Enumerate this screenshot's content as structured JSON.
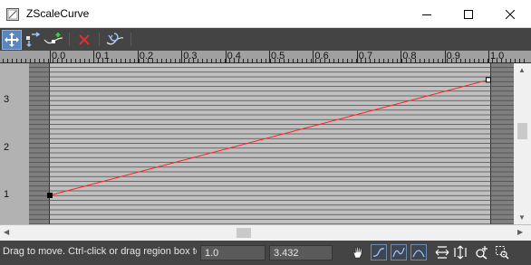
{
  "window": {
    "title": "ZScaleCurve",
    "minimize_icon": "minimize-icon",
    "maximize_icon": "maximize-icon",
    "close_icon": "close-icon"
  },
  "toolbar": {
    "tools": [
      "move-icon",
      "scale-point-icon",
      "insert-point-icon",
      "delete-point-icon",
      "reset-curve-icon"
    ]
  },
  "ruler": {
    "ticks": [
      "0.0",
      "0.1",
      "0.2",
      "0.3",
      "0.4",
      "0.5",
      "0.6",
      "0.7",
      "0.8",
      "0.9",
      "1.0"
    ]
  },
  "y_axis": {
    "labels": [
      "3",
      "2",
      "1"
    ]
  },
  "curve": {
    "points": [
      {
        "x": 0.0,
        "y": 1.0
      },
      {
        "x": 1.0,
        "y": 3.432
      }
    ],
    "color": "#ff2020"
  },
  "status": {
    "message": "Drag to move. Ctrl-click or drag region box to select.",
    "x_value": "1.0",
    "y_value": "3.432"
  },
  "status_tools": [
    "pan-icon",
    "zoom-extents-icon",
    "zoom-horizontal-extents-icon",
    "zoom-vertical-extents-icon",
    "zoom-horizontal-icon",
    "zoom-vertical-icon",
    "zoom-icon",
    "zoom-region-icon"
  ]
}
